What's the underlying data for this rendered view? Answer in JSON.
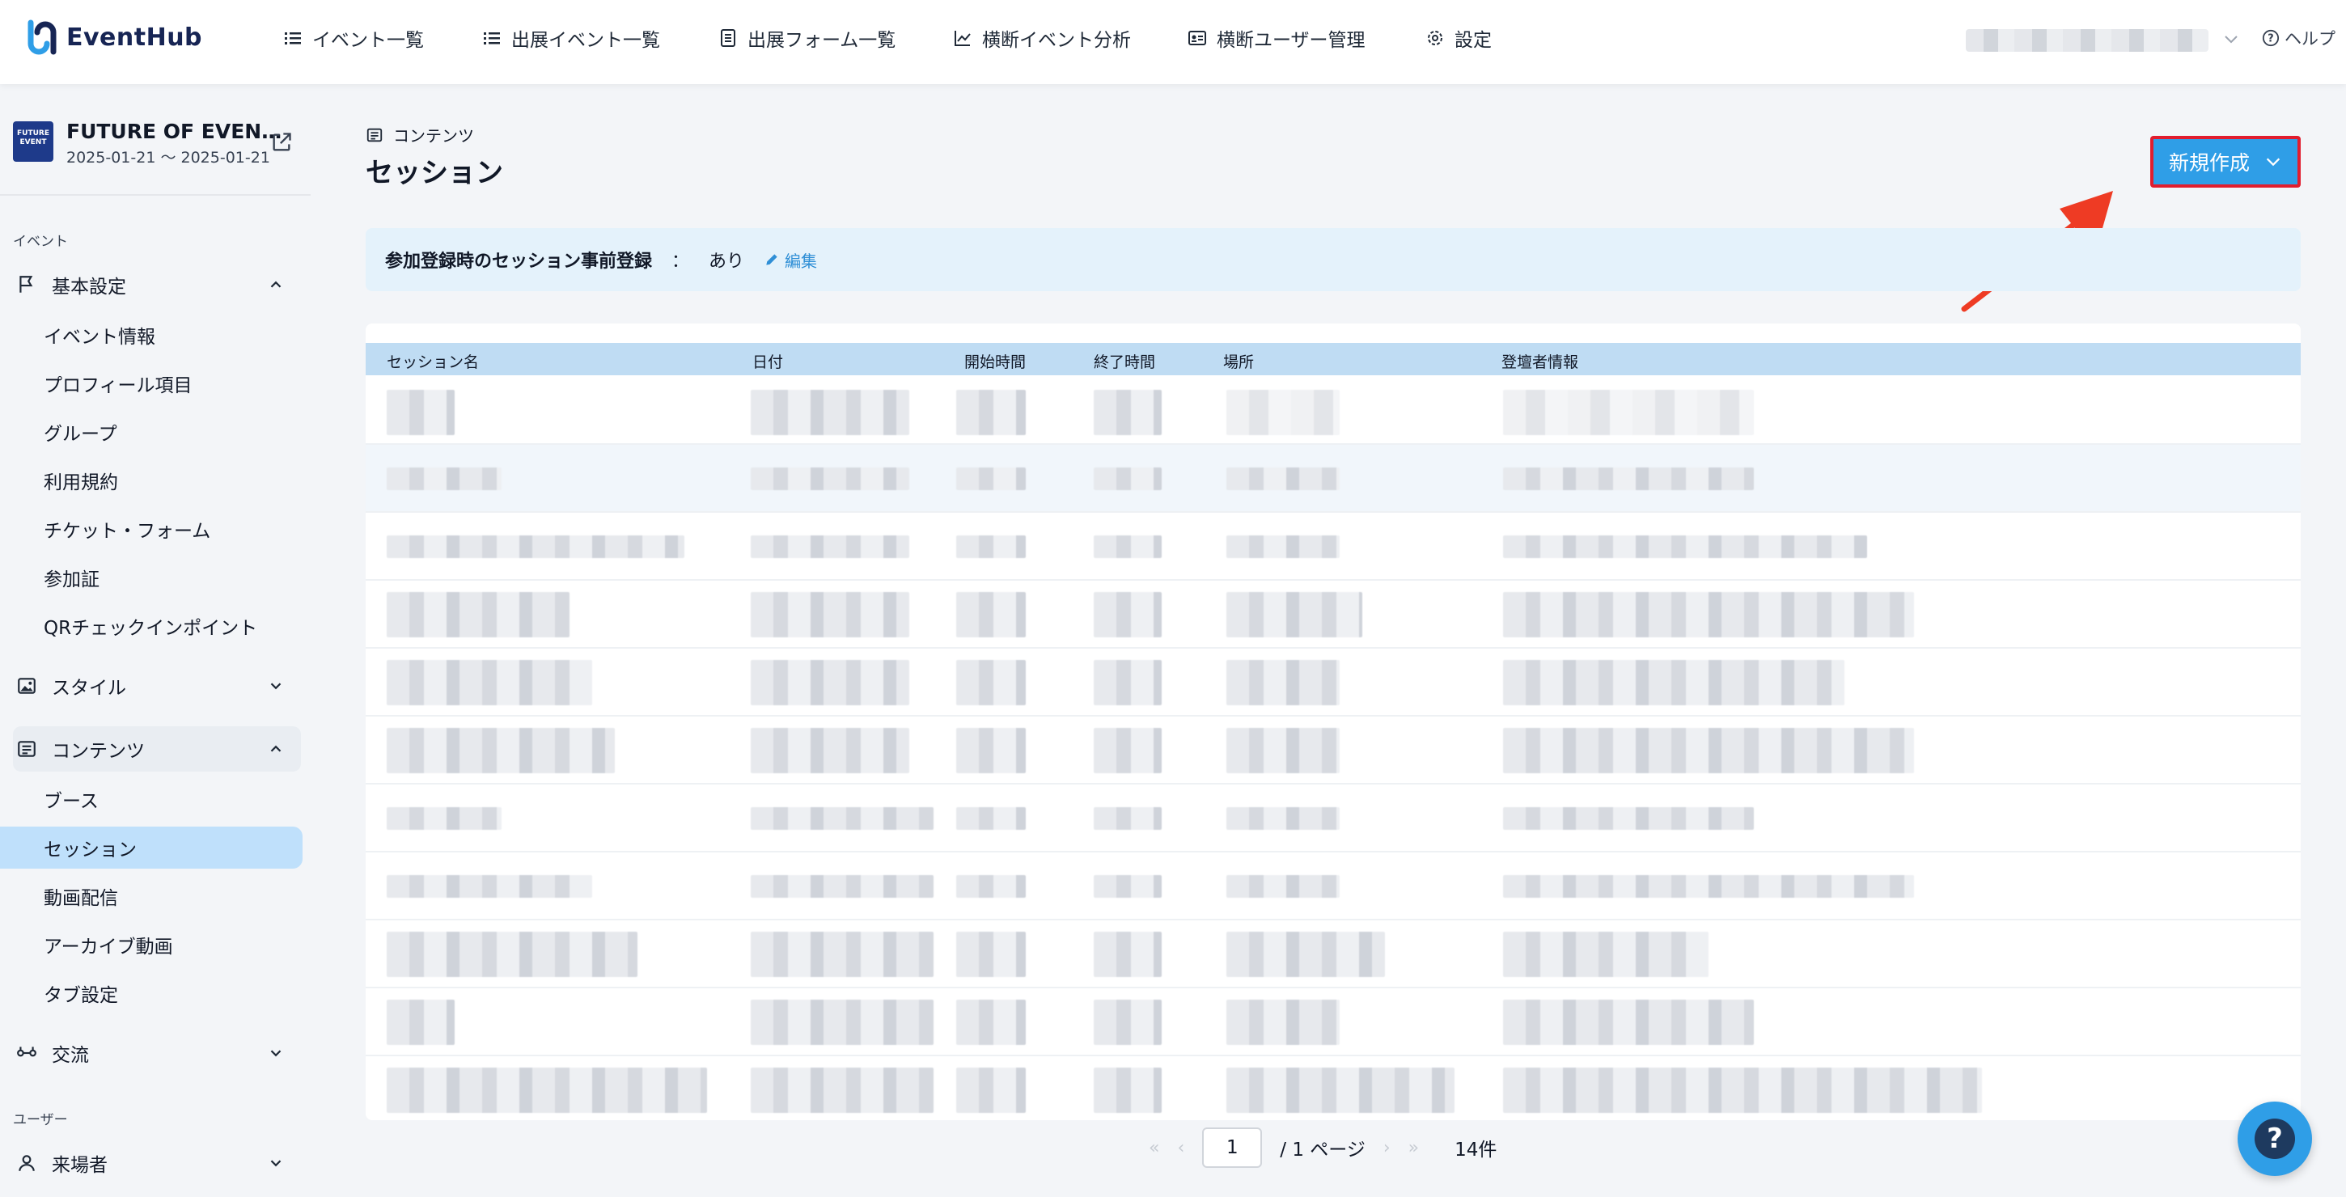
{
  "app": {
    "name": "EventHub"
  },
  "colors": {
    "accent": "#2f9ee7",
    "highlight_border": "#e11d2e",
    "arrow": "#ee3b24",
    "active_nav": "#bfe0fb"
  },
  "topnav": {
    "items": [
      {
        "icon": "list-icon",
        "label": "イベント一覧"
      },
      {
        "icon": "list-icon",
        "label": "出展イベント一覧"
      },
      {
        "icon": "form-icon",
        "label": "出展フォーム一覧"
      },
      {
        "icon": "chart-icon",
        "label": "横断イベント分析"
      },
      {
        "icon": "id-card-icon",
        "label": "横断ユーザー管理"
      },
      {
        "icon": "gear-icon",
        "label": "設定"
      }
    ],
    "help": "ヘルプ"
  },
  "event": {
    "title": "FUTURE OF EVEN…",
    "dates": "2025-01-21 ～ 2025-01-21",
    "logo_text": "FUTURE EVENT"
  },
  "sidebar": {
    "section_event": "イベント",
    "section_user": "ユーザー",
    "groups": {
      "basic": "基本設定",
      "style": "スタイル",
      "content": "コンテンツ",
      "exchange": "交流",
      "visitor": "来場者"
    },
    "basic_items": [
      "イベント情報",
      "プロフィール項目",
      "グループ",
      "利用規約",
      "チケット・フォーム",
      "参加証",
      "QRチェックインポイント"
    ],
    "content_items": [
      "ブース",
      "セッション",
      "動画配信",
      "アーカイブ動画",
      "タブ設定"
    ]
  },
  "main": {
    "breadcrumb": "コンテンツ",
    "title": "セッション",
    "new_button": "新規作成",
    "notice": {
      "label": "参加登録時のセッション事前登録",
      "separator": "：",
      "value": "あり",
      "edit": "編集"
    },
    "columns": [
      "セッション名",
      "日付",
      "開始時間",
      "終了時間",
      "場所",
      "登壇者情報"
    ]
  },
  "pagination": {
    "current_page": "1",
    "pages_label": "/ 1 ページ",
    "total": "14件"
  }
}
